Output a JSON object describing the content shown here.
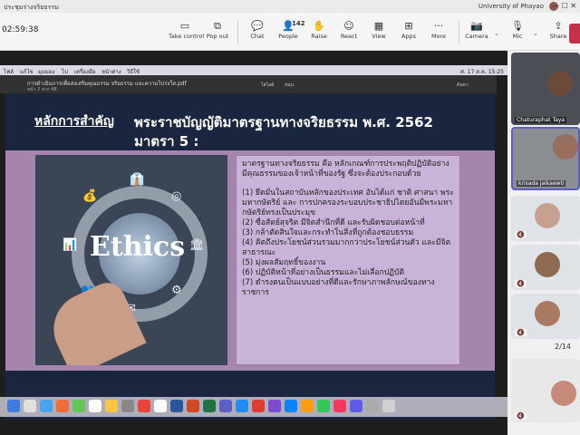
{
  "window": {
    "title": "ประชุมร่างจริยธรรม",
    "org": "University of Phayao",
    "win_controls": "— ☐ ✕",
    "timer": "02:59:38"
  },
  "toolbar": {
    "take_control": "Take control",
    "pop_out": "Pop out",
    "chat": "Chat",
    "people": "People",
    "people_count": "142",
    "raise": "Raise",
    "react": "React",
    "view": "View",
    "apps": "Apps",
    "more": "More",
    "camera": "Camera",
    "mic": "Mic",
    "share": "Share"
  },
  "mac": {
    "menu": [
      "ไฟล์",
      "แก้ไข",
      "มุมมอง",
      "ไป",
      "เครื่องมือ",
      "หน้าต่าง",
      "วิธีใช้"
    ],
    "clock": "ศ. 17 ส.ค. 15:25"
  },
  "pdf": {
    "filename": "การดำเนินการเพื่อส่งเสริมคุณธรรม จริยธรรม และความโปร่งใส.pdf",
    "page": "หน้า 2 จาก 48",
    "tools": [
      "ไฮไลต์",
      "หมุน",
      "ค้นหา"
    ]
  },
  "slide": {
    "key_label": "หลักการสำคัญ",
    "title_line1": "พระราชบัญญัติมาตรฐานทางจริยธรรม พ.ศ. 2562",
    "title_line2": "มาตรา 5 :",
    "photo_word": "Ethics",
    "intro": "มาตรฐานทางจริยธรรม คือ หลักเกณฑ์การประพฤติปฏิบัติอย่างมีคุณธรรมของเจ้าหน้าที่ของรัฐ ซึ่งจะต้องประกอบด้วย",
    "items": [
      "(1) ยึดมั่นในสถาบันหลักของประเทศ อันได้แก่ ชาติ ศาสนา พระมหากษัตริย์ และ การปกครองระบอบประชาธิปไตยอันมีพระมหากษัตริย์ทรงเป็นประมุข",
      "(2) ซื่อสัตย์สุจริต มีจิตสำนึกที่ดี และรับผิดชอบต่อหน้าที่",
      "(3) กล้าตัดสินใจและกระทำในสิ่งที่ถูกต้องชอบธรรม",
      "(4) คิดถึงประโยชน์ส่วนรวมมากกว่าประโยชน์ส่วนตัว และมีจิตสาธารณะ",
      "(5) มุ่งผลสัมฤทธิ์ของงาน",
      "(6) ปฏิบัติหน้าที่อย่างเป็นธรรมและไม่เลือกปฏิบัติ",
      "(7) ดำรงตนเป็นแบบอย่างที่ดีและรักษาภาพลักษณ์ของทางราชการ"
    ]
  },
  "participants": {
    "p1": "Chaturaphat Taya",
    "p2": "krisada jaikaewti",
    "pager": "2/14"
  }
}
